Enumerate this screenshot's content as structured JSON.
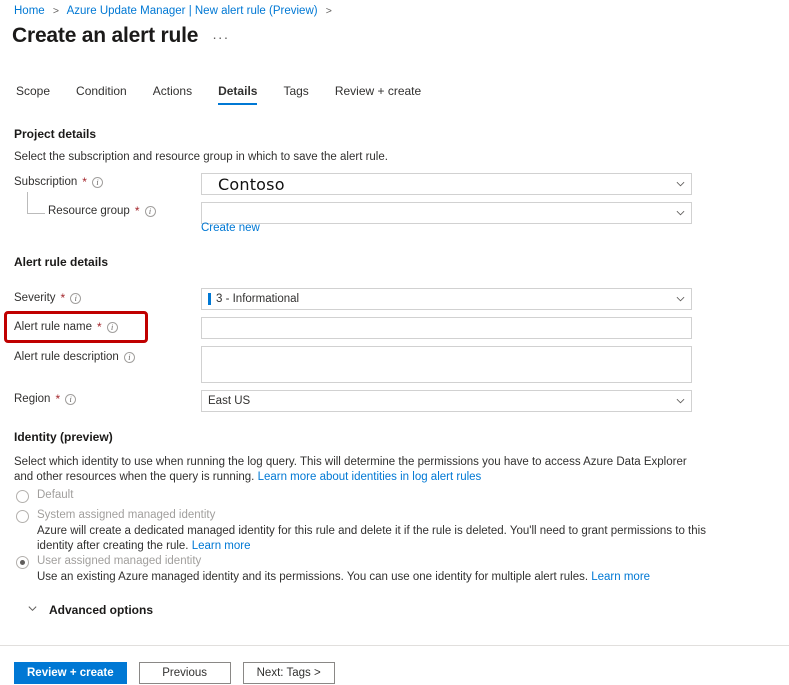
{
  "breadcrumb": {
    "items": [
      "Home",
      "Azure Update Manager | New alert rule (Preview)"
    ],
    "separator": ">"
  },
  "header": {
    "title": "Create an alert rule",
    "more_label": "···"
  },
  "tabs": [
    {
      "label": "Scope",
      "active": false
    },
    {
      "label": "Condition",
      "active": false
    },
    {
      "label": "Actions",
      "active": false
    },
    {
      "label": "Details",
      "active": true
    },
    {
      "label": "Tags",
      "active": false
    },
    {
      "label": "Review + create",
      "active": false
    }
  ],
  "project_details": {
    "heading": "Project details",
    "description": "Select the subscription and resource group in which to save the alert rule.",
    "subscription": {
      "label": "Subscription",
      "required": "*",
      "value": "Contoso",
      "chevron": "chevron-down-icon"
    },
    "resource_group": {
      "label": "Resource group",
      "required": "*",
      "value": "",
      "create_new_label": "Create new",
      "chevron": "chevron-down-icon"
    }
  },
  "alert_rule_details": {
    "heading": "Alert rule details",
    "severity": {
      "label": "Severity",
      "required": "*",
      "value": "3 - Informational",
      "indicator_color": "#0078d4"
    },
    "alert_rule_name": {
      "label": "Alert rule name",
      "required": "*",
      "value": "",
      "highlighted": true,
      "highlight_color": "#c00000"
    },
    "alert_rule_description": {
      "label": "Alert rule description",
      "value": ""
    },
    "region": {
      "label": "Region",
      "required": "*",
      "value": "East US"
    }
  },
  "identity": {
    "heading": "Identity (preview)",
    "description_part1": "Select which identity to use when running the log query. This will determine the permissions you have to access Azure Data Explorer and other resources when the query is running. ",
    "description_link": "Learn more about identities in log alert rules",
    "options": [
      {
        "label": "Default",
        "selected": false,
        "sub": "",
        "sub_link": ""
      },
      {
        "label": "System assigned managed identity",
        "selected": false,
        "sub": "Azure will create a dedicated managed identity for this rule and delete it if the rule is deleted. You'll need to grant permissions to this identity after creating the rule. ",
        "sub_link": "Learn more"
      },
      {
        "label": "User assigned managed identity",
        "selected": true,
        "sub": "Use an existing Azure managed identity and its permissions. You can use one identity for multiple alert rules. ",
        "sub_link": "Learn more"
      }
    ]
  },
  "advanced_options": {
    "label": "Advanced options",
    "chevron": "chevron-down-icon",
    "expanded": false
  },
  "footer": {
    "buttons": [
      {
        "label": "Review + create",
        "primary": true
      },
      {
        "label": "Previous",
        "primary": false
      },
      {
        "label": "Next: Tags >",
        "primary": false
      }
    ]
  },
  "colors": {
    "accent": "#0078d4",
    "required": "#a4262c",
    "highlight": "#c00000"
  }
}
